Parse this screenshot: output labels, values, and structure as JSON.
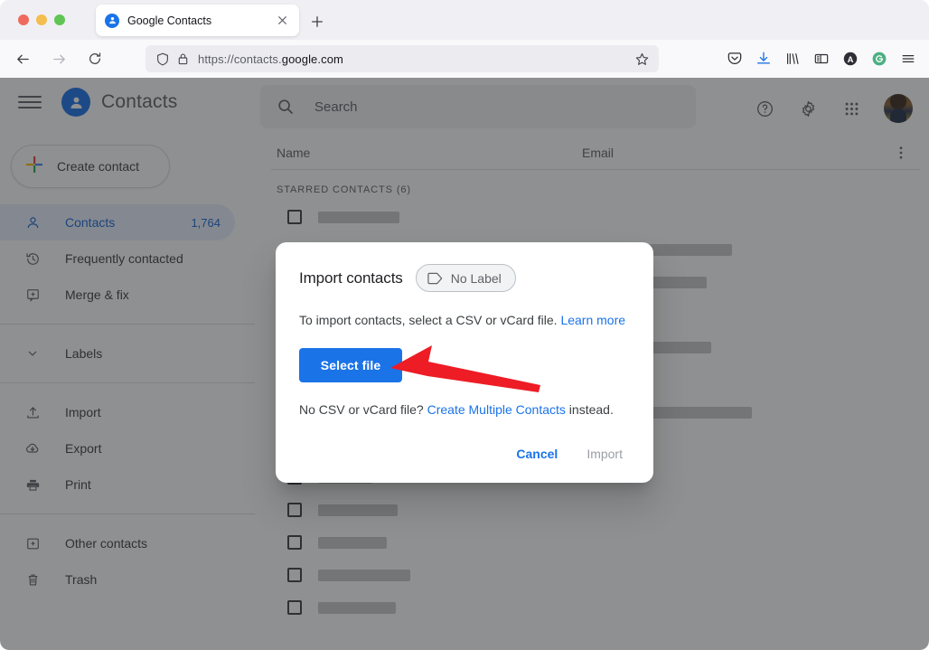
{
  "browser": {
    "tab": {
      "title": "Google Contacts",
      "favicon": "person-icon",
      "close": "close-icon"
    },
    "new_tab": "plus-icon",
    "nav": {
      "back": "back-arrow-icon",
      "forward": "forward-arrow-icon",
      "reload": "reload-icon"
    },
    "url": {
      "scheme": "https://contacts.",
      "domain": "google.com",
      "shield": "shield-icon",
      "lock": "lock-icon",
      "bookmark": "star-icon"
    },
    "toolbar_icons": [
      "pocket-icon",
      "download-icon",
      "library-icon",
      "sidebar-icon",
      "account-icon",
      "grammarly-icon",
      "menu-icon"
    ]
  },
  "app": {
    "menu": "hamburger-icon",
    "logo": "contacts-logo-icon",
    "title": "Contacts",
    "create_button": {
      "label": "Create contact",
      "icon": "plus-colored-icon"
    },
    "nav_items": [
      {
        "label": "Contacts",
        "icon": "person-outline-icon",
        "count": "1,764",
        "active": true
      },
      {
        "label": "Frequently contacted",
        "icon": "history-icon",
        "count": "",
        "active": false
      },
      {
        "label": "Merge & fix",
        "icon": "merge-icon",
        "count": "",
        "active": false
      }
    ],
    "labels_section": {
      "label": "Labels",
      "icon": "chevron-down-icon"
    },
    "tools_items": [
      {
        "label": "Import",
        "icon": "upload-icon"
      },
      {
        "label": "Export",
        "icon": "cloud-download-icon"
      },
      {
        "label": "Print",
        "icon": "printer-icon"
      }
    ],
    "other_items": [
      {
        "label": "Other contacts",
        "icon": "archive-icon"
      },
      {
        "label": "Trash",
        "icon": "trash-icon"
      }
    ]
  },
  "main": {
    "search": {
      "placeholder": "Search",
      "icon": "search-icon"
    },
    "header_icons": [
      "help-icon",
      "settings-icon",
      "apps-grid-icon"
    ],
    "avatar": "user-avatar",
    "columns": {
      "name": "Name",
      "email": "Email",
      "more": "more-vertical-icon"
    },
    "section_label": "STARRED CONTACTS (6)"
  },
  "dialog": {
    "title": "Import contacts",
    "chip": {
      "label": "No Label",
      "icon": "label-tag-icon"
    },
    "description_prefix": "To import contacts, select a CSV or vCard file. ",
    "description_link": "Learn more",
    "select_file_label": "Select file",
    "alt_prefix": "No CSV or vCard file? ",
    "alt_link": "Create Multiple Contacts",
    "alt_suffix": " instead.",
    "cancel_label": "Cancel",
    "import_label": "Import"
  },
  "annotation": {
    "type": "arrow",
    "color": "#ee1c25",
    "points_to": "select-file-button"
  },
  "colors": {
    "accent_blue": "#1a73e8",
    "button_blue": "#1b73e8",
    "active_nav_bg": "#e8f0fe",
    "active_nav_fg": "#1967d2",
    "scrim": "rgba(32,33,36,0.50)",
    "annotation_red": "#ee1c25",
    "text_primary": "#202124",
    "text_secondary": "#5f6368",
    "disabled_text": "#9aa0a6"
  }
}
